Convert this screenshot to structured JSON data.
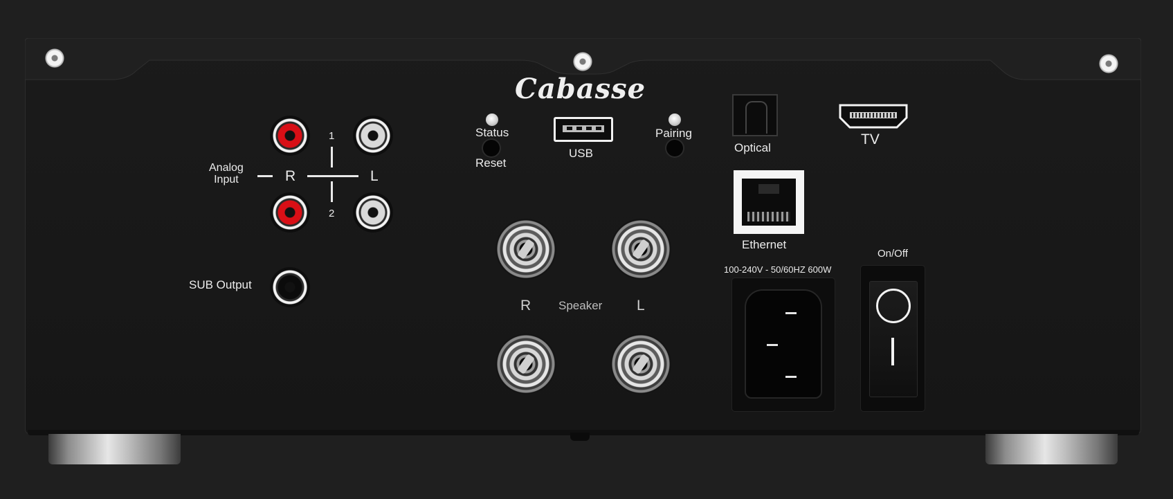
{
  "brand": {
    "logo_text": "Cabasse"
  },
  "analog_input": {
    "label_line1": "Analog",
    "label_line2": "Input",
    "right_label": "R",
    "left_label": "L",
    "input1_label": "1",
    "input2_label": "2"
  },
  "sub_output": {
    "label": "SUB Output"
  },
  "status": {
    "label": "Status",
    "button_label": "Reset"
  },
  "usb": {
    "label": "USB"
  },
  "pairing": {
    "label": "Pairing"
  },
  "optical": {
    "label": "Optical"
  },
  "hdmi": {
    "label": "TV"
  },
  "ethernet": {
    "label": "Ethernet"
  },
  "speaker": {
    "label": "Speaker",
    "right_label": "R",
    "left_label": "L"
  },
  "power": {
    "rating": "100-240V - 50/60HZ  600W",
    "switch_label": "On/Off"
  },
  "colors": {
    "background": "#1f1f1f",
    "panel": "#171717",
    "rca_red": "#d80f16",
    "rca_white": "#d9d9d9",
    "print": "#ececec"
  },
  "icons": [
    "screw-icon",
    "usb-port-icon",
    "optical-port-icon",
    "hdmi-port-icon",
    "ethernet-port-icon",
    "power-inlet-icon",
    "power-switch-icon"
  ]
}
